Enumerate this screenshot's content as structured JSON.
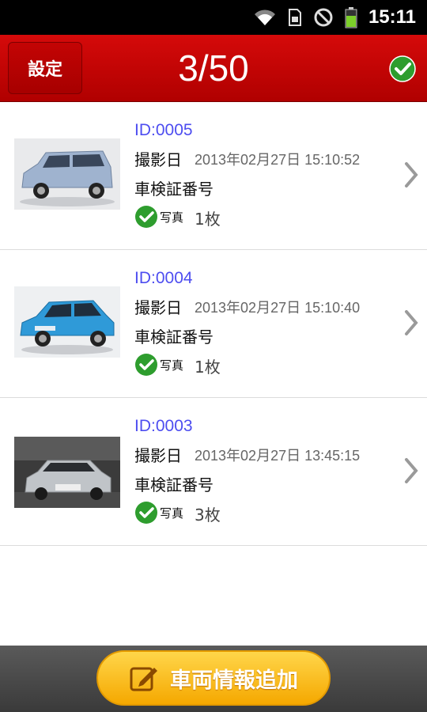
{
  "status_bar": {
    "time": "15:11"
  },
  "header": {
    "settings_label": "設定",
    "counter": "3/50"
  },
  "entries": [
    {
      "id": "ID:0005",
      "date_label": "撮影日",
      "date_value": "2013年02月27日 15:10:52",
      "reg_label": "車検証番号",
      "photo_label": "写真",
      "photo_count": "1枚",
      "car_color": "#9fb3cf"
    },
    {
      "id": "ID:0004",
      "date_label": "撮影日",
      "date_value": "2013年02月27日 15:10:40",
      "reg_label": "車検証番号",
      "photo_label": "写真",
      "photo_count": "1枚",
      "car_color": "#2f9ad8"
    },
    {
      "id": "ID:0003",
      "date_label": "撮影日",
      "date_value": "2013年02月27日 13:45:15",
      "reg_label": "車検証番号",
      "photo_label": "写真",
      "photo_count": "3枚",
      "car_color": "#c0c4c8"
    }
  ],
  "bottom": {
    "add_label": "車両情報追加"
  },
  "colors": {
    "header_red": "#c40000",
    "id_blue": "#4d4df0",
    "check_green": "#2e9d2e",
    "button_orange": "#f5b400"
  }
}
